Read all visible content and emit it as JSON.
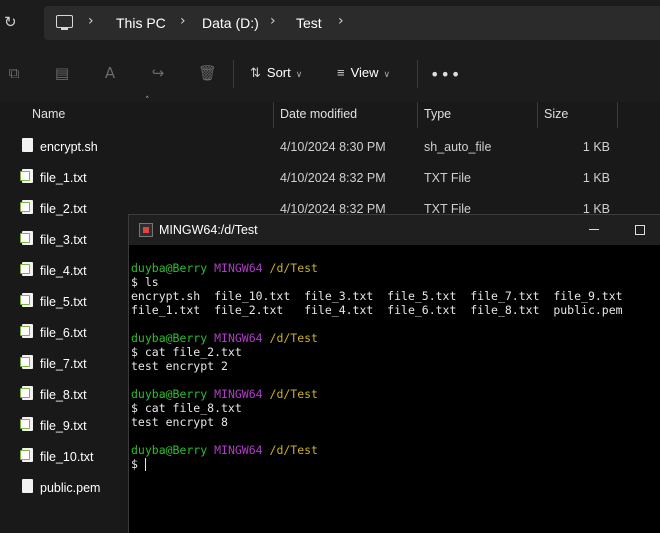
{
  "address_bar": {
    "crumbs": [
      "This PC",
      "Data (D:)",
      "Test"
    ]
  },
  "toolbar": {
    "sort_label": "Sort",
    "view_label": "View"
  },
  "columns": [
    "Name",
    "Date modified",
    "Type",
    "Size"
  ],
  "files": [
    {
      "name": "encrypt.sh",
      "date": "4/10/2024 8:30 PM",
      "type": "sh_auto_file",
      "size": "1 KB",
      "icon": "file-icon"
    },
    {
      "name": "file_1.txt",
      "date": "4/10/2024 8:32 PM",
      "type": "TXT File",
      "size": "1 KB",
      "icon": "text-file-icon"
    },
    {
      "name": "file_2.txt",
      "date": "4/10/2024 8:32 PM",
      "type": "TXT File",
      "size": "1 KB",
      "icon": "text-file-icon"
    },
    {
      "name": "file_3.txt",
      "date": "",
      "type": "",
      "size": "",
      "icon": "text-file-icon"
    },
    {
      "name": "file_4.txt",
      "date": "",
      "type": "",
      "size": "",
      "icon": "text-file-icon"
    },
    {
      "name": "file_5.txt",
      "date": "",
      "type": "",
      "size": "",
      "icon": "text-file-icon"
    },
    {
      "name": "file_6.txt",
      "date": "",
      "type": "",
      "size": "",
      "icon": "text-file-icon"
    },
    {
      "name": "file_7.txt",
      "date": "",
      "type": "",
      "size": "",
      "icon": "text-file-icon"
    },
    {
      "name": "file_8.txt",
      "date": "",
      "type": "",
      "size": "",
      "icon": "text-file-icon"
    },
    {
      "name": "file_9.txt",
      "date": "",
      "type": "",
      "size": "",
      "icon": "text-file-icon"
    },
    {
      "name": "file_10.txt",
      "date": "",
      "type": "",
      "size": "",
      "icon": "text-file-icon"
    },
    {
      "name": "public.pem",
      "date": "",
      "type": "",
      "size": "",
      "icon": "file-icon"
    }
  ],
  "terminal": {
    "title": "MINGW64:/d/Test",
    "prompt": {
      "user": "duyba@Berry",
      "host": "MINGW64",
      "path": "/d/Test"
    },
    "blocks": [
      {
        "command": "$ ls",
        "output": [
          "encrypt.sh  file_10.txt  file_3.txt  file_5.txt  file_7.txt  file_9.txt",
          "file_1.txt  file_2.txt   file_4.txt  file_6.txt  file_8.txt  public.pem"
        ]
      },
      {
        "command": "$ cat file_2.txt",
        "output": [
          "test encrypt 2"
        ]
      },
      {
        "command": "$ cat file_8.txt",
        "output": [
          "test encrypt 8"
        ]
      },
      {
        "command": "$ ",
        "output": []
      }
    ]
  },
  "colors": {
    "prompt_user": "#2bbf2b",
    "prompt_host": "#b03cc8",
    "prompt_path": "#c9b027"
  }
}
